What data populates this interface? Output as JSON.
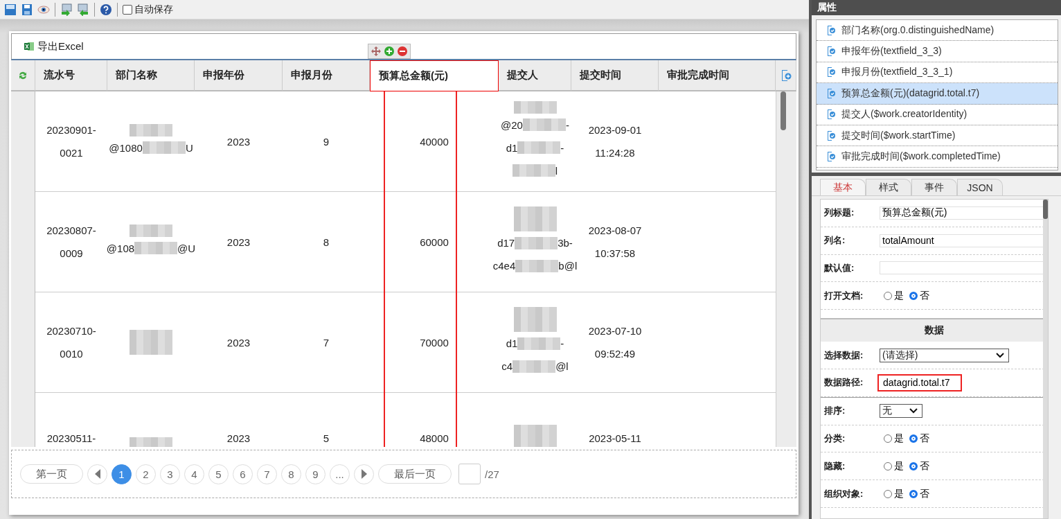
{
  "toolbar": {
    "autosave": {
      "label": "自动保存",
      "checked": false
    }
  },
  "export_button": {
    "label": "导出Excel"
  },
  "table": {
    "columns": [
      {
        "label": "流水号",
        "selected": false
      },
      {
        "label": "部门名称",
        "selected": false
      },
      {
        "label": "申报年份",
        "selected": false
      },
      {
        "label": "申报月份",
        "selected": false
      },
      {
        "label": "预算总金额(元)",
        "selected": true
      },
      {
        "label": "提交人",
        "selected": false
      },
      {
        "label": "提交时间",
        "selected": false
      },
      {
        "label": "审批完成时间",
        "selected": false
      }
    ],
    "rows": [
      {
        "cells": [
          [
            [
              {
                "kind": "text",
                "text": "20230901-"
              }
            ],
            [
              {
                "kind": "text",
                "text": "0021"
              }
            ]
          ],
          [
            [
              {
                "kind": "redacted"
              }
            ],
            [
              {
                "kind": "text",
                "text": "@1080"
              },
              {
                "kind": "redacted"
              },
              {
                "kind": "text",
                "text": "U"
              }
            ]
          ],
          [
            [
              {
                "kind": "text",
                "text": "2023"
              }
            ]
          ],
          [
            [
              {
                "kind": "text",
                "text": "9"
              }
            ]
          ],
          [
            [
              {
                "kind": "text",
                "text": "40000"
              }
            ]
          ],
          [
            [
              {
                "kind": "redacted"
              }
            ],
            [
              {
                "kind": "text",
                "text": "@20"
              },
              {
                "kind": "redacted"
              },
              {
                "kind": "text",
                "text": "-"
              }
            ],
            [
              {
                "kind": "text",
                "text": "d1"
              },
              {
                "kind": "redacted"
              },
              {
                "kind": "text",
                "text": "-"
              }
            ],
            [
              {
                "kind": "redacted"
              },
              {
                "kind": "text",
                "text": "l"
              }
            ]
          ],
          [
            [
              {
                "kind": "text",
                "text": "2023-09-01"
              }
            ],
            [
              {
                "kind": "text",
                "text": "11:24:28"
              }
            ]
          ],
          []
        ]
      },
      {
        "cells": [
          [
            [
              {
                "kind": "text",
                "text": "20230807-"
              }
            ],
            [
              {
                "kind": "text",
                "text": "0009"
              }
            ]
          ],
          [
            [
              {
                "kind": "redacted"
              }
            ],
            [
              {
                "kind": "text",
                "text": "@108"
              },
              {
                "kind": "redacted"
              },
              {
                "kind": "text",
                "text": "@U"
              }
            ]
          ],
          [
            [
              {
                "kind": "text",
                "text": "2023"
              }
            ]
          ],
          [
            [
              {
                "kind": "text",
                "text": "8"
              }
            ]
          ],
          [
            [
              {
                "kind": "text",
                "text": "60000"
              }
            ]
          ],
          [
            [
              {
                "kind": "redacted"
              }
            ],
            [
              {
                "kind": "redacted"
              }
            ],
            [
              {
                "kind": "text",
                "text": "d17"
              },
              {
                "kind": "redacted"
              },
              {
                "kind": "text",
                "text": "3b-"
              }
            ],
            [
              {
                "kind": "text",
                "text": "c4e4"
              },
              {
                "kind": "redacted"
              },
              {
                "kind": "text",
                "text": "b@l"
              }
            ]
          ],
          [
            [
              {
                "kind": "text",
                "text": "2023-08-07"
              }
            ],
            [
              {
                "kind": "text",
                "text": "10:37:58"
              }
            ]
          ],
          []
        ]
      },
      {
        "cells": [
          [
            [
              {
                "kind": "text",
                "text": "20230710-"
              }
            ],
            [
              {
                "kind": "text",
                "text": "0010"
              }
            ]
          ],
          [
            [
              {
                "kind": "redacted"
              }
            ],
            [
              {
                "kind": "redacted"
              }
            ]
          ],
          [
            [
              {
                "kind": "text",
                "text": "2023"
              }
            ]
          ],
          [
            [
              {
                "kind": "text",
                "text": "7"
              }
            ]
          ],
          [
            [
              {
                "kind": "text",
                "text": "70000"
              }
            ]
          ],
          [
            [
              {
                "kind": "redacted"
              }
            ],
            [
              {
                "kind": "redacted"
              }
            ],
            [
              {
                "kind": "text",
                "text": "d1"
              },
              {
                "kind": "redacted"
              },
              {
                "kind": "text",
                "text": "-"
              }
            ],
            [
              {
                "kind": "text",
                "text": "c4"
              },
              {
                "kind": "redacted"
              },
              {
                "kind": "text",
                "text": "@l"
              }
            ]
          ],
          [
            [
              {
                "kind": "text",
                "text": "2023-07-10"
              }
            ],
            [
              {
                "kind": "text",
                "text": "09:52:49"
              }
            ]
          ],
          []
        ]
      },
      {
        "cells": [
          [
            [
              {
                "kind": "text",
                "text": "20230511-"
              }
            ]
          ],
          [
            [
              {
                "kind": "redacted"
              }
            ]
          ],
          [
            [
              {
                "kind": "text",
                "text": "2023"
              }
            ]
          ],
          [
            [
              {
                "kind": "text",
                "text": "5"
              }
            ]
          ],
          [
            [
              {
                "kind": "text",
                "text": "48000"
              }
            ]
          ],
          [
            [
              {
                "kind": "redacted"
              }
            ],
            [
              {
                "kind": "redacted"
              }
            ]
          ],
          [
            [
              {
                "kind": "text",
                "text": "2023-05-11"
              }
            ]
          ],
          []
        ]
      }
    ]
  },
  "pagination": {
    "first": "第一页",
    "pages": [
      {
        "label": "1",
        "selected": true
      },
      {
        "label": "2",
        "selected": false
      },
      {
        "label": "3",
        "selected": false
      },
      {
        "label": "4",
        "selected": false
      },
      {
        "label": "5",
        "selected": false
      },
      {
        "label": "6",
        "selected": false
      },
      {
        "label": "7",
        "selected": false
      },
      {
        "label": "8",
        "selected": false
      },
      {
        "label": "9",
        "selected": false
      },
      {
        "label": "...",
        "selected": false
      }
    ],
    "last": "最后一页",
    "total": "/27"
  },
  "properties_panel": {
    "title": "属性",
    "fields": [
      {
        "label": "部门名称(org.0.distinguishedName)",
        "selected": false
      },
      {
        "label": "申报年份(textfield_3_3)",
        "selected": false
      },
      {
        "label": "申报月份(textfield_3_3_1)",
        "selected": false
      },
      {
        "label": "预算总金额(元)(datagrid.total.t7)",
        "selected": true
      },
      {
        "label": "提交人($work.creatorIdentity)",
        "selected": false
      },
      {
        "label": "提交时间($work.startTime)",
        "selected": false
      },
      {
        "label": "审批完成时间($work.completedTime)",
        "selected": false
      }
    ],
    "tabs": [
      {
        "label": "基本",
        "selected": true
      },
      {
        "label": "样式",
        "selected": false
      },
      {
        "label": "事件",
        "selected": false
      },
      {
        "label": "JSON",
        "selected": false
      }
    ],
    "props": [
      {
        "kind": "text",
        "label": "列标题:",
        "value": "预算总金额(元)",
        "highlighted": false
      },
      {
        "kind": "text",
        "label": "列名:",
        "value": "totalAmount",
        "highlighted": false
      },
      {
        "kind": "text",
        "label": "默认值:",
        "highlighted": false
      },
      {
        "kind": "radio",
        "label": "打开文档:",
        "options": [
          {
            "label": "是",
            "selected": false
          },
          {
            "label": "否",
            "selected": true
          }
        ]
      },
      {
        "kind": "section",
        "label": "数据"
      },
      {
        "kind": "select",
        "label": "选择数据:",
        "value": "(请选择)"
      },
      {
        "kind": "text",
        "label": "数据路径:",
        "value": "datagrid.total.t7",
        "highlighted": true
      },
      {
        "kind": "select_short",
        "label": "排序:",
        "value": "无"
      },
      {
        "kind": "radio",
        "label": "分类:",
        "options": [
          {
            "label": "是",
            "selected": false
          },
          {
            "label": "否",
            "selected": true
          }
        ]
      },
      {
        "kind": "radio",
        "label": "隐藏:",
        "options": [
          {
            "label": "是",
            "selected": false
          },
          {
            "label": "否",
            "selected": true
          }
        ]
      },
      {
        "kind": "radio",
        "label": "组织对象:",
        "options": [
          {
            "label": "是",
            "selected": false
          },
          {
            "label": "否",
            "selected": true
          }
        ]
      }
    ]
  }
}
